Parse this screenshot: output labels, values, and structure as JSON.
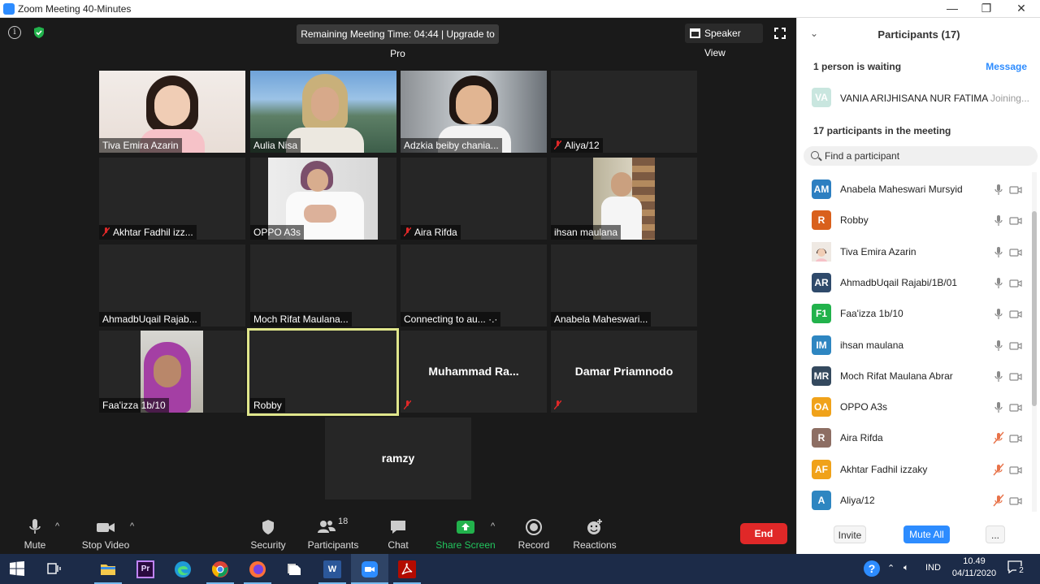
{
  "window": {
    "title": "Zoom Meeting 40-Minutes",
    "minimize": "—",
    "restore": "❐",
    "close": "✕"
  },
  "top": {
    "timer": "Remaining Meeting Time: 04:44 | Upgrade to Pro",
    "speaker_view": "Speaker View"
  },
  "tiles": [
    {
      "name": "Tiva Emira Azarin",
      "muted": false,
      "video": true
    },
    {
      "name": "Aulia Nisa",
      "muted": false,
      "video": true
    },
    {
      "name": "Adzkia beiby chania...",
      "muted": false,
      "video": true
    },
    {
      "name": "Aliya/12",
      "muted": true,
      "video": false
    },
    {
      "name": "Akhtar Fadhil izz...",
      "muted": true,
      "video": false
    },
    {
      "name": "OPPO A3s",
      "muted": false,
      "video": true
    },
    {
      "name": "Aira Rifda",
      "muted": true,
      "video": false
    },
    {
      "name": "ihsan maulana",
      "muted": false,
      "video": true
    },
    {
      "name": "AhmadbUqail Rajab...",
      "muted": false,
      "video": false
    },
    {
      "name": "Moch Rifat Maulana...",
      "muted": false,
      "video": false
    },
    {
      "name": "Connecting to au... ·.·",
      "muted": false,
      "video": false
    },
    {
      "name": "Anabela Maheswari...",
      "muted": false,
      "video": false
    },
    {
      "name": "Faa'izza 1b/10",
      "muted": false,
      "video": true
    },
    {
      "name": "Robby",
      "muted": false,
      "video": false,
      "active": true
    },
    {
      "big": "Muhammad  Ra...",
      "muted": true
    },
    {
      "big": "Damar Priamnodo",
      "muted": true
    },
    {
      "big": "ramzy"
    }
  ],
  "toolbar": {
    "mute": "Mute",
    "stop_video": "Stop Video",
    "security": "Security",
    "participants": "Participants",
    "participants_count": "18",
    "chat": "Chat",
    "share_screen": "Share Screen",
    "record": "Record",
    "reactions": "Reactions",
    "end": "End",
    "caret": "^"
  },
  "panel": {
    "title": "Participants (17)",
    "collapse": "⌄",
    "waiting_label": "1 person is waiting",
    "message": "Message",
    "waiting": {
      "initials": "VA",
      "name": "VANIA ARIJHISANA NUR FATIMA",
      "status": "Joining..."
    },
    "in_meeting_label": "17 participants in the meeting",
    "search_placeholder": "Find a participant",
    "participants": [
      {
        "initials": "AM",
        "name": "Anabela Maheswari Mursyid",
        "color": "#2d7fc1",
        "muted": false
      },
      {
        "initials": "R",
        "name": "Robby",
        "color": "#d9601c",
        "muted": false,
        "speaking": true
      },
      {
        "initials": "",
        "name": "Tiva Emira Azarin",
        "color": "#c9b9a9",
        "muted": false
      },
      {
        "initials": "AR",
        "name": "AhmadbUqail Rajabi/1B/01",
        "color": "#2f4a6b",
        "muted": false
      },
      {
        "initials": "F1",
        "name": "Faa'izza 1b/10",
        "color": "#22b24c",
        "muted": false
      },
      {
        "initials": "IM",
        "name": "ihsan maulana",
        "color": "#2e86c1",
        "muted": false
      },
      {
        "initials": "MR",
        "name": "Moch Rifat Maulana Abrar",
        "color": "#34495e",
        "muted": false
      },
      {
        "initials": "OA",
        "name": "OPPO A3s",
        "color": "#f0a21a",
        "muted": false
      },
      {
        "initials": "R",
        "name": "Aira Rifda",
        "color": "#8d6e63",
        "muted": true
      },
      {
        "initials": "AF",
        "name": "Akhtar Fadhil izzaky",
        "color": "#f0a21a",
        "muted": true
      },
      {
        "initials": "A",
        "name": "Aliya/12",
        "color": "#2e86c1",
        "muted": true
      }
    ],
    "invite": "Invite",
    "mute_all": "Mute All",
    "more": "..."
  },
  "taskbar": {
    "lang": "IND",
    "time": "10.49",
    "date": "04/11/2020",
    "notif_count": "2"
  }
}
